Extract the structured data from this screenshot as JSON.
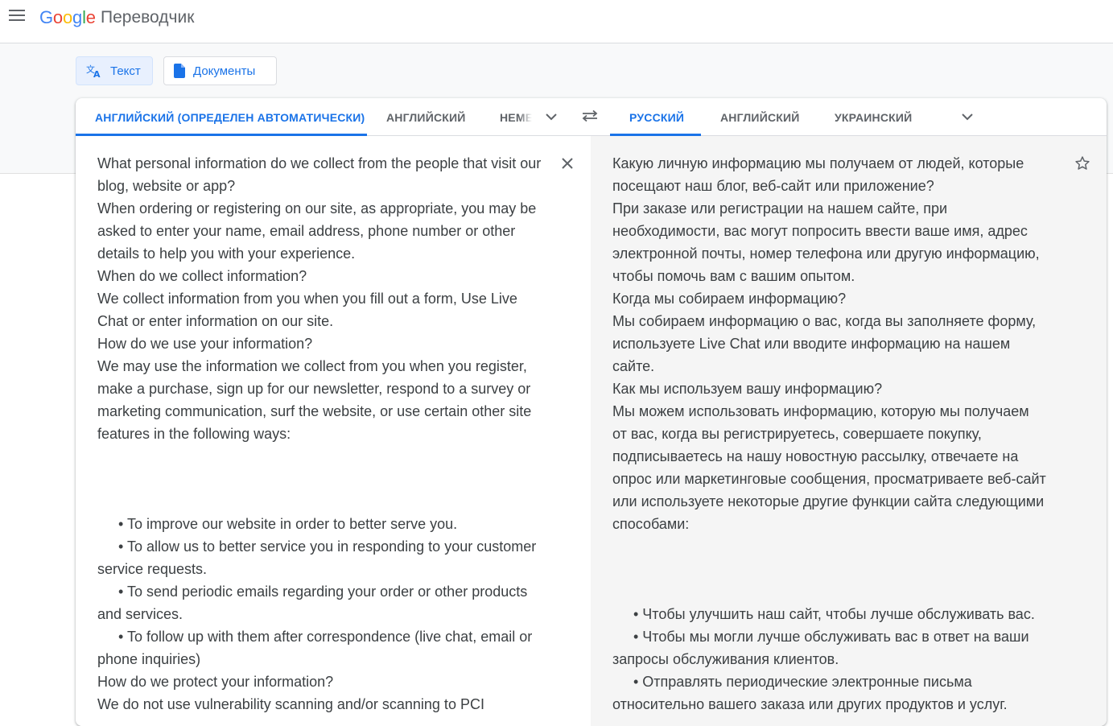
{
  "header": {
    "logo_letters": [
      "G",
      "o",
      "o",
      "g",
      "l",
      "e"
    ],
    "product_name": "Переводчик",
    "icons": {
      "menu": "hamburger-menu-icon"
    }
  },
  "modes": [
    {
      "label": "Текст",
      "icon": "translate-icon",
      "active": true
    },
    {
      "label": "Документы",
      "icon": "document-icon",
      "active": false
    }
  ],
  "source_languages": [
    {
      "label": "АНГЛИЙСКИЙ (ОПРЕДЕЛЕН АВТОМАТИЧЕСКИ)",
      "active": true
    },
    {
      "label": "АНГЛИЙСКИЙ",
      "active": false
    },
    {
      "label": "НЕМЕ",
      "active": false
    }
  ],
  "target_languages": [
    {
      "label": "РУССКИЙ",
      "active": true
    },
    {
      "label": "АНГЛИЙСКИЙ",
      "active": false
    },
    {
      "label": "УКРАИНСКИЙ",
      "active": false
    }
  ],
  "source": {
    "paragraph_1_lines": [
      "What personal information do we collect from the people that visit our",
      "blog, website or app?",
      "When ordering or registering on our site, as appropriate, you may be",
      "asked to enter your name, email address, phone number or other",
      "details to help you with your experience.",
      "When do we collect information?",
      "We collect information from you when you fill out a form, Use Live",
      "Chat or enter information on our site.",
      "How do we use your information?",
      "We may use the information we collect from you when you register,",
      "make a purchase, sign up for our newsletter, respond to a survey or",
      "marketing communication, surf the website, or use certain other site",
      "features in the following ways:"
    ],
    "paragraph_2_lines": [
      {
        "text": "• To improve our website in order to better serve you.",
        "indent": true
      },
      {
        "text": "• To allow us to better service you in responding to your customer",
        "indent": true
      },
      {
        "text": "service requests.",
        "indent": false
      },
      {
        "text": "• To send periodic emails regarding your order or other products",
        "indent": true
      },
      {
        "text": "and services.",
        "indent": false
      },
      {
        "text": "• To follow up with them after correspondence (live chat, email or",
        "indent": true
      },
      {
        "text": "phone inquiries)",
        "indent": false
      },
      {
        "text": "How do we protect your information?",
        "indent": false
      },
      {
        "text": "We do not use vulnerability scanning and/or scanning to PCI",
        "indent": false
      }
    ]
  },
  "target": {
    "paragraph_1_lines": [
      "Какую личную информацию мы получаем от людей, которые",
      "посещают наш блог, веб-сайт или приложение?",
      "При заказе или регистрации на нашем сайте, при",
      "необходимости, вас могут попросить ввести ваше имя, адрес",
      "электронной почты, номер телефона или другую информацию,",
      "чтобы помочь вам с вашим опытом.",
      "Когда мы собираем информацию?",
      "Мы собираем информацию о вас, когда вы заполняете форму,",
      "используете Live Chat или вводите информацию на нашем",
      "сайте.",
      "Как мы используем вашу информацию?",
      "Мы можем использовать информацию, которую мы получаем",
      "от вас, когда вы регистрируетесь, совершаете покупку,",
      "подписываетесь на нашу новостную рассылку, отвечаете на",
      "опрос или маркетинговые сообщения, просматриваете веб-сайт",
      "или используете некоторые другие функции сайта следующими",
      "способами:"
    ],
    "paragraph_2_lines": [
      {
        "text": "• Чтобы улучшить наш сайт, чтобы лучше обслуживать вас.",
        "indent": true
      },
      {
        "text": "• Чтобы мы могли лучше обслуживать вас в ответ на ваши",
        "indent": true
      },
      {
        "text": "запросы обслуживания клиентов.",
        "indent": false
      },
      {
        "text": "• Отправлять периодические электронные письма",
        "indent": true
      },
      {
        "text": "относительно вашего заказа или других продуктов и услуг.",
        "indent": false
      }
    ]
  },
  "icons": {
    "source_more": "chevron-down-icon",
    "swap": "swap-languages-icon",
    "target_more": "chevron-down-icon",
    "clear": "close-icon",
    "save": "star-icon"
  },
  "colors": {
    "accent": "#1a73e8",
    "active_mode_bg": "#e8f0fe",
    "band_bg": "#f8f9fa",
    "target_pane_bg": "#f5f5f5",
    "text": "#3c4043",
    "inactive_tab": "#5f6368"
  }
}
